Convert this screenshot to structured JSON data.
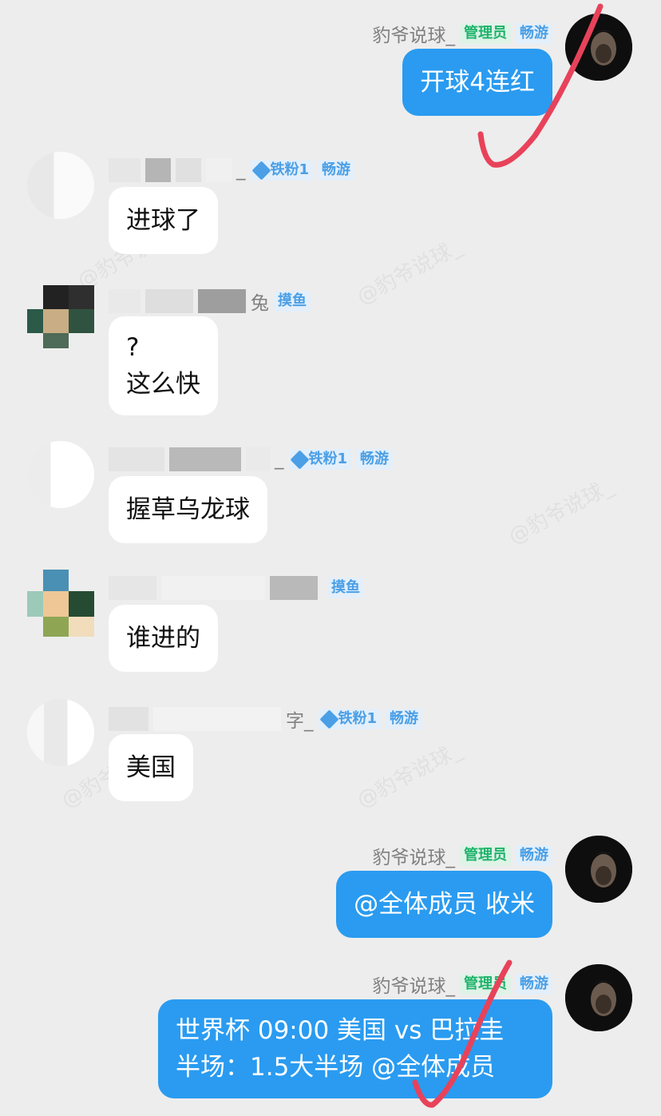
{
  "messages": [
    {
      "side": "me",
      "name": "豹爷说球_",
      "badges": [
        "管理员",
        "畅游"
      ],
      "text": "开球4连红"
    },
    {
      "side": "other",
      "name_suffix": "_",
      "badges": [
        "铁粉1",
        "畅游"
      ],
      "text": "进球了"
    },
    {
      "side": "other",
      "name_suffix": "兔",
      "badges": [
        "摸鱼"
      ],
      "text": "?\n这么快"
    },
    {
      "side": "other",
      "name_suffix": "_",
      "badges": [
        "铁粉1",
        "畅游"
      ],
      "text": "握草乌龙球"
    },
    {
      "side": "other",
      "name_suffix": "",
      "badges": [
        "摸鱼"
      ],
      "text": "谁进的"
    },
    {
      "side": "other",
      "name_suffix": "字_",
      "badges": [
        "铁粉1",
        "畅游"
      ],
      "text": "美国"
    },
    {
      "side": "me",
      "name": "豹爷说球_",
      "badges": [
        "管理员",
        "畅游"
      ],
      "text": "@全体成员 收米"
    },
    {
      "side": "me",
      "name": "豹爷说球_",
      "badges": [
        "管理员",
        "畅游"
      ],
      "text": "世界杯 09:00 美国 vs 巴拉圭\n半场：1.5大半场 @全体成员"
    }
  ],
  "watermark": "@豹爷说球_",
  "colors": {
    "bubble_me": "#2a9bf0",
    "check": "#e8425a",
    "admin_badge": "#1fb26b",
    "blue_badge": "#4a9fe6"
  },
  "icons": {
    "admin_avatar": "player-portrait-icon",
    "fan_badge": "diamond-icon",
    "annotation": "red-checkmark-icon"
  }
}
